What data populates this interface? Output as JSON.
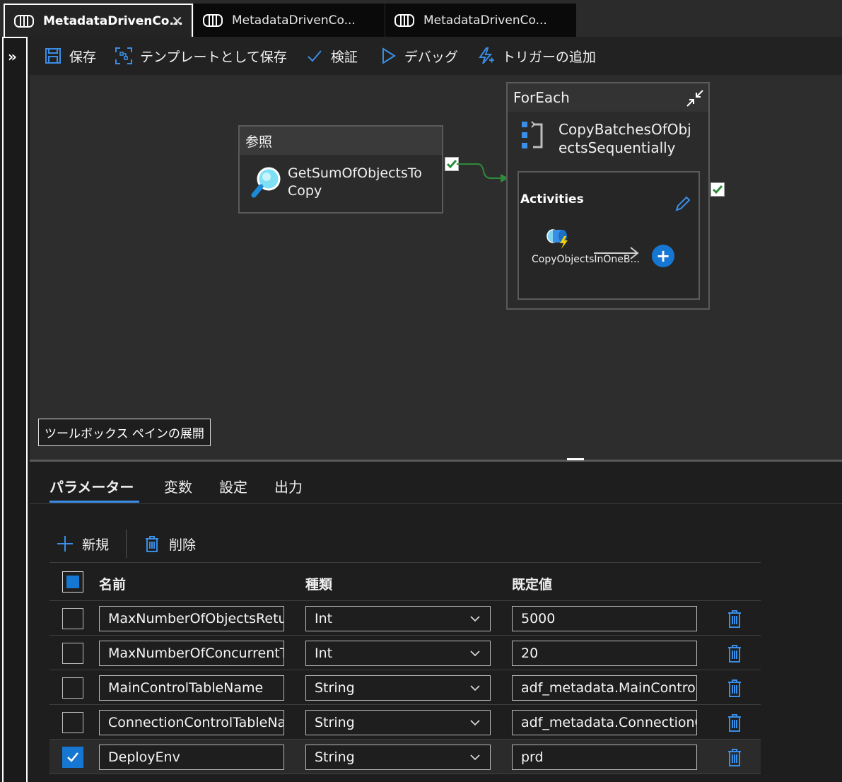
{
  "tabs": [
    {
      "label": "MetadataDrivenCo...",
      "active": true
    },
    {
      "label": "MetadataDrivenCo...",
      "active": false
    },
    {
      "label": "MetadataDrivenCo...",
      "active": false
    }
  ],
  "toolbar": {
    "save": "保存",
    "save_as_template": "テンプレートとして保存",
    "validate": "検証",
    "debug": "デバッグ",
    "add_trigger": "トリガーの追加"
  },
  "canvas": {
    "lookup": {
      "type_label": "参照",
      "name": "GetSumOfObjectsToCopy",
      "icon": "lookup-magnifier-icon"
    },
    "foreach": {
      "type_label": "ForEach",
      "name": "CopyBatchesOfObjectsSequentially",
      "inner_title": "Activities",
      "inner_activity": "CopyObjectsInOneB...",
      "icon": "foreach-loop-icon"
    },
    "toolbox_tooltip": "ツールボックス ペインの展開"
  },
  "panel": {
    "tabs": [
      "パラメーター",
      "変数",
      "設定",
      "出力"
    ],
    "active_tab": "パラメーター",
    "new_label": "新規",
    "delete_label": "削除",
    "columns": {
      "name": "名前",
      "type": "種類",
      "default": "既定値"
    },
    "rows": [
      {
        "name": "MaxNumberOfObjectsRetur",
        "type": "Int",
        "default": "5000",
        "checked": false
      },
      {
        "name": "MaxNumberOfConcurrentTa",
        "type": "Int",
        "default": "20",
        "checked": false
      },
      {
        "name": "MainControlTableName",
        "type": "String",
        "default": "adf_metadata.MainControlT",
        "checked": false
      },
      {
        "name": "ConnectionControlTableNar",
        "type": "String",
        "default": "adf_metadata.ConnectionCc",
        "checked": false
      },
      {
        "name": "DeployEnv",
        "type": "String",
        "default": "prd",
        "checked": true
      }
    ]
  },
  "colors": {
    "accent": "#1677d2",
    "success": "#2e8b3a"
  }
}
